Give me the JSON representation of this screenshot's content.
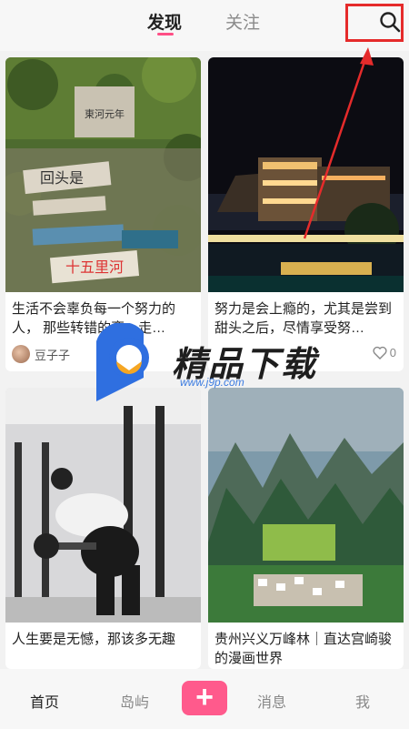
{
  "header": {
    "tabs": [
      {
        "label": "发现",
        "active": true
      },
      {
        "label": "关注",
        "active": false
      }
    ],
    "search_icon": "search-icon",
    "accent_color": "#ff4f86",
    "highlight_color": "#e52b2b"
  },
  "feed": {
    "cards": [
      {
        "caption": "生活不会辜负每一个努力的人，  那些转错的弯，走…",
        "author": "豆子子",
        "likes": "",
        "image": "ivy-covered stone wall with signs",
        "sign_text": [
          "東河元年",
          "回头是",
          "十五里河"
        ]
      },
      {
        "caption": "努力是会上瘾的，尤其是尝到甜头之后，尽情享受努…",
        "author": "豆子子",
        "likes": "0",
        "image": "night riverside town buildings"
      },
      {
        "caption": "人生要是无憾，那该多无趣",
        "author": "",
        "likes": "",
        "image": "woman lifting weights in gym"
      },
      {
        "caption": "贵州兴义万峰林｜直达宫崎骏的漫画世界",
        "author": "",
        "likes": "",
        "image": "karst mountain valley village"
      }
    ]
  },
  "watermark": {
    "title": "精品下载",
    "url": "www.j9p.com"
  },
  "bottom_nav": {
    "items": [
      "首页",
      "岛屿",
      "消息",
      "我"
    ],
    "publish": "+"
  }
}
